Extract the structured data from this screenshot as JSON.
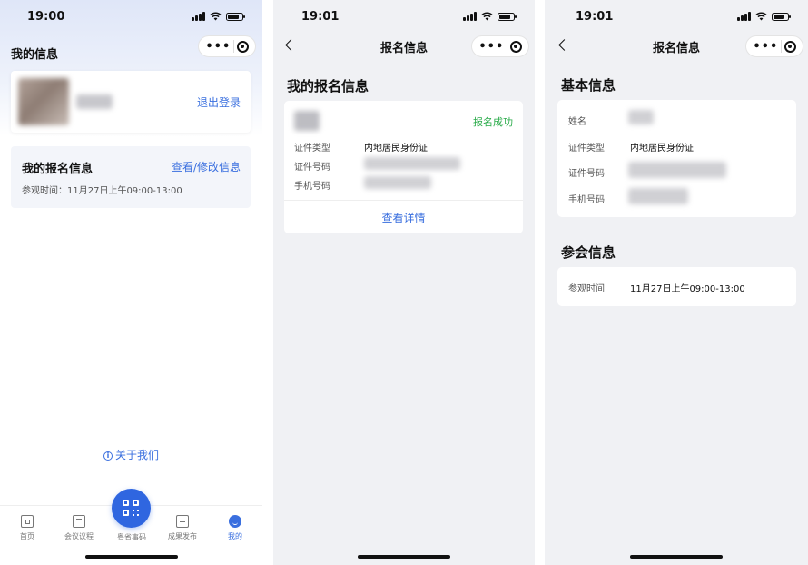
{
  "screen1": {
    "time": "19:00",
    "title": "我的信息",
    "logout_label": "退出登录",
    "registration": {
      "title": "我的报名信息",
      "link": "查看/修改信息",
      "visit_time": "参观时间：11月27日上午09:00-13:00"
    },
    "about_label": "关于我们",
    "tabs": [
      {
        "label": "首页",
        "icon": "home-icon"
      },
      {
        "label": "会议议程",
        "icon": "agenda-icon"
      },
      {
        "label": "粤省事码",
        "icon": "qr-code-icon"
      },
      {
        "label": "成果发布",
        "icon": "publish-icon"
      },
      {
        "label": "我的",
        "icon": "profile-icon"
      }
    ],
    "active_tab": "我的"
  },
  "screen2": {
    "time": "19:01",
    "nav_title": "报名信息",
    "section_title": "我的报名信息",
    "status": "报名成功",
    "rows": [
      {
        "label": "证件类型",
        "value": "内地居民身份证"
      },
      {
        "label": "证件号码",
        "value": ""
      },
      {
        "label": "手机号码",
        "value": ""
      }
    ],
    "detail_link": "查看详情"
  },
  "screen3": {
    "time": "19:01",
    "nav_title": "报名信息",
    "basic_title": "基本信息",
    "basic_rows": [
      {
        "label": "姓名",
        "value": ""
      },
      {
        "label": "证件类型",
        "value": "内地居民身份证"
      },
      {
        "label": "证件号码",
        "value": ""
      },
      {
        "label": "手机号码",
        "value": ""
      }
    ],
    "meeting_title": "参会信息",
    "meeting_rows": [
      {
        "label": "参观时间",
        "value": "11月27日上午09:00-13:00"
      }
    ]
  },
  "colors": {
    "accent": "#3a6fdf",
    "qr_button": "#2f66e0",
    "success": "#2aab4a",
    "page_bg": "#f0f1f4"
  }
}
